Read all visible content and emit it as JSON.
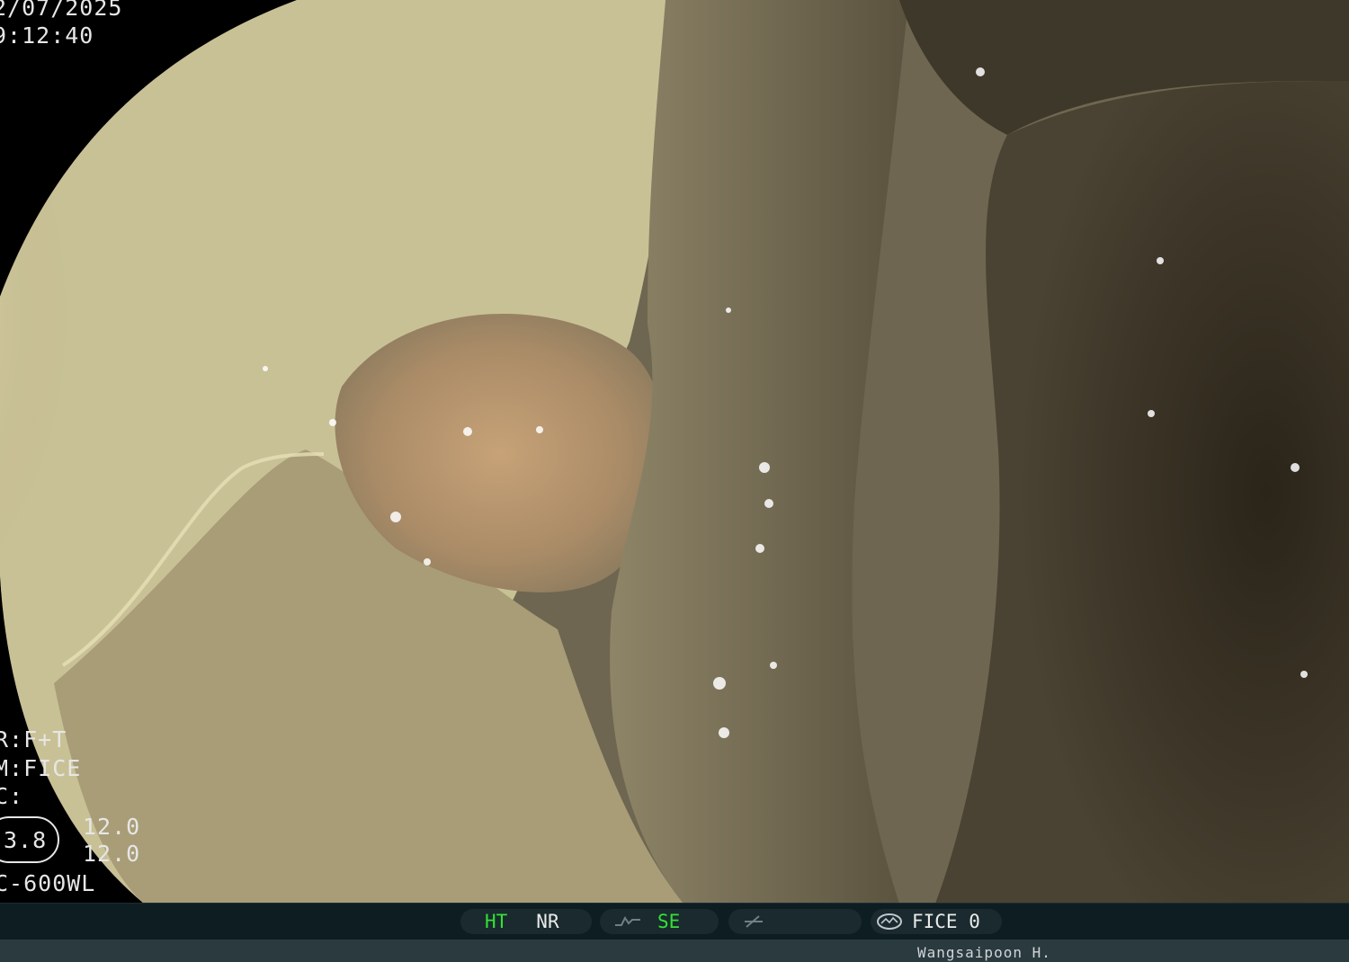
{
  "overlay": {
    "date": "2/07/2025",
    "time": "9:12:40",
    "line_ft": "R:F+T",
    "line_mode": "M:FICE",
    "line_c": "C:",
    "scope_value": "3.8",
    "value_upper": "12.0",
    "value_lower": "12.0",
    "scope_model": "C-600WL"
  },
  "status_bar": {
    "ht": "HT",
    "nr": "NR",
    "se": "SE",
    "fice": "FICE 0",
    "icons": [
      "waveform-icon",
      "enhance-slash-icon",
      "fice-eye-icon"
    ]
  },
  "footer": {
    "operator": "Wangsaipoon H."
  },
  "colors": {
    "background": "#000000",
    "bar": "#0e1d21",
    "footer": "#2b3a3f",
    "active_green": "#33e233",
    "osd_text": "#e6e6e6"
  }
}
